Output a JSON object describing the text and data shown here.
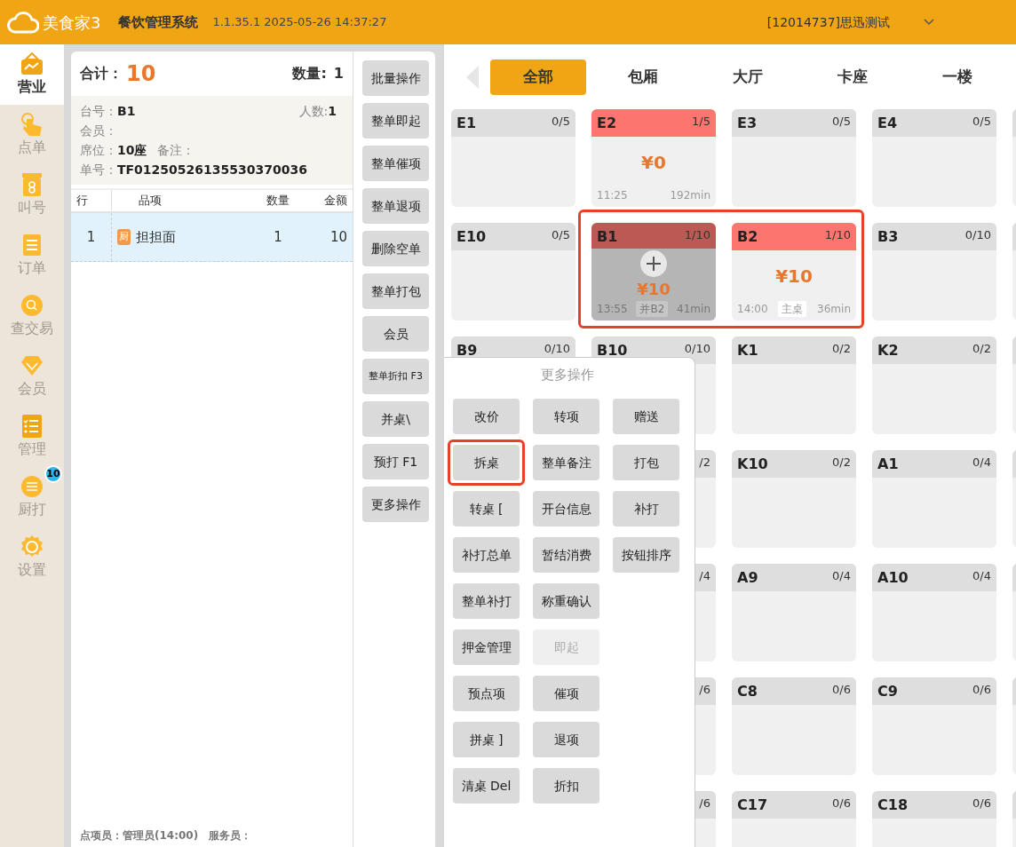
{
  "header": {
    "logo": "美食家3",
    "system": "餐饮管理系统",
    "version": "1.1.35.1 2025-05-26 14:37:27",
    "account": "[12014737]思迅测试"
  },
  "sidebar": {
    "items": [
      {
        "label": "营业",
        "selected": true
      },
      {
        "label": "点单",
        "selected": false
      },
      {
        "label": "叫号",
        "selected": false
      },
      {
        "label": "订单",
        "selected": false
      },
      {
        "label": "查交易",
        "selected": false
      },
      {
        "label": "会员",
        "selected": false
      },
      {
        "label": "管理",
        "selected": false
      },
      {
        "label": "厨打",
        "selected": false,
        "badge": "10"
      },
      {
        "label": "设置",
        "selected": false
      }
    ]
  },
  "order": {
    "total_label": "合计：",
    "total": "10",
    "qty_label": "数量:",
    "qty": "1",
    "info": [
      [
        {
          "label": "台号：",
          "value": "B1"
        },
        {
          "label": "人数:",
          "value": "1"
        }
      ],
      [
        {
          "label": "会员："
        }
      ],
      [
        {
          "label": "席位：",
          "value": "10座"
        },
        {
          "label": "备注："
        }
      ],
      [
        {
          "label": "单号：",
          "value": "TF01250526135530370036"
        }
      ]
    ],
    "columns": [
      "行",
      "品项",
      "数量",
      "金额"
    ],
    "rows": [
      {
        "line": "1",
        "tag": "厨",
        "item": "担担面",
        "qty": "1",
        "amount": "10",
        "selected": true
      }
    ],
    "footer": [
      {
        "label": "点项员：",
        "value": "管理员(14:00)"
      },
      {
        "label": "服务员："
      }
    ]
  },
  "actions": [
    {
      "label": "批量操作"
    },
    {
      "label": "整单即起"
    },
    {
      "label": "整单催项"
    },
    {
      "label": "整单退项"
    },
    {
      "label": "删除空单"
    },
    {
      "label": "整单打包"
    },
    {
      "label": "会员"
    },
    {
      "label": "整单折扣 F3",
      "small": true
    },
    {
      "label": "并桌\\"
    },
    {
      "label": "预打 F1"
    },
    {
      "label": "更多操作"
    }
  ],
  "areas": [
    {
      "label": "全部",
      "selected": true
    },
    {
      "label": "包厢",
      "selected": false
    },
    {
      "label": "大厅",
      "selected": false
    },
    {
      "label": "卡座",
      "selected": false
    },
    {
      "label": "一楼",
      "selected": false
    }
  ],
  "table_rows": [
    [
      {
        "name": "E1",
        "count": "0/5",
        "kind": "idle"
      },
      {
        "name": "E2",
        "count": "1/5",
        "kind": "occupied",
        "amount": "¥0",
        "time": "11:25",
        "duration": "192min"
      },
      {
        "name": "E3",
        "count": "0/5",
        "kind": "idle"
      },
      {
        "name": "E4",
        "count": "0/5",
        "kind": "idle"
      },
      {
        "kind": "idle"
      }
    ],
    [
      {
        "name": "E10",
        "count": "0/5",
        "kind": "idle"
      },
      {
        "name": "B1",
        "count": "1/10",
        "kind": "merged",
        "amount": "¥10",
        "time": "13:55",
        "tag": "并B2",
        "duration": "41min",
        "outlined": true
      },
      {
        "name": "B2",
        "count": "1/10",
        "kind": "occupied",
        "amount": "¥10",
        "time": "14:00",
        "tag": "主桌",
        "duration": "36min",
        "outlined": true
      },
      {
        "name": "B3",
        "count": "0/10",
        "kind": "idle"
      },
      {
        "kind": "idle"
      }
    ],
    [
      {
        "name": "B9",
        "count": "0/10",
        "kind": "idle"
      },
      {
        "name": "B10",
        "count": "0/10",
        "kind": "idle"
      },
      {
        "name": "K1",
        "count": "0/2",
        "kind": "idle"
      },
      {
        "name": "K2",
        "count": "0/2",
        "kind": "idle"
      },
      {
        "kind": "idle"
      }
    ],
    [
      null,
      {
        "count": "/2",
        "kind": "idle"
      },
      {
        "name": "K10",
        "count": "0/2",
        "kind": "idle"
      },
      {
        "name": "A1",
        "count": "0/4",
        "kind": "idle"
      },
      {
        "kind": "idle"
      }
    ],
    [
      null,
      {
        "count": "/4",
        "kind": "idle"
      },
      {
        "name": "A9",
        "count": "0/4",
        "kind": "idle"
      },
      {
        "name": "A10",
        "count": "0/4",
        "kind": "idle"
      },
      {
        "kind": "idle"
      }
    ],
    [
      null,
      {
        "count": "/6",
        "kind": "idle"
      },
      {
        "name": "C8",
        "count": "0/6",
        "kind": "idle"
      },
      {
        "name": "C9",
        "count": "0/6",
        "kind": "idle"
      },
      {
        "kind": "idle"
      }
    ],
    [
      null,
      {
        "count": "/6",
        "kind": "idle"
      },
      {
        "name": "C17",
        "count": "0/6",
        "kind": "idle"
      },
      {
        "name": "C18",
        "count": "0/6",
        "kind": "idle"
      },
      {
        "kind": "idle"
      }
    ]
  ],
  "more_menu": {
    "title": "更多操作",
    "rows": [
      [
        {
          "label": "改价",
          "disabled": false
        },
        {
          "label": "转项",
          "disabled": false
        },
        {
          "label": "赠送",
          "disabled": false
        }
      ],
      [
        {
          "label": "拆桌",
          "disabled": false,
          "outlined": true
        },
        {
          "label": "整单备注",
          "disabled": false
        },
        {
          "label": "打包",
          "disabled": false
        }
      ],
      [
        {
          "label": "转桌 [",
          "disabled": false
        },
        {
          "label": "开台信息",
          "disabled": false
        },
        {
          "label": "补打",
          "disabled": false
        }
      ],
      [
        {
          "label": "补打总单",
          "disabled": false
        },
        {
          "label": "暂结消费",
          "disabled": false
        },
        {
          "label": "按钮排序",
          "disabled": false
        }
      ],
      [
        {
          "label": "整单补打",
          "disabled": false
        },
        {
          "label": "称重确认",
          "disabled": false
        }
      ],
      [
        {
          "label": "押金管理",
          "disabled": false
        },
        {
          "label": "即起",
          "disabled": true
        }
      ],
      [
        {
          "label": "预点项",
          "disabled": false
        },
        {
          "label": "催项",
          "disabled": false
        }
      ],
      [
        {
          "label": "拼桌 ]",
          "disabled": false
        },
        {
          "label": "退项",
          "disabled": false
        }
      ],
      [
        {
          "label": "清桌 Del",
          "disabled": false
        },
        {
          "label": "折扣",
          "disabled": false
        }
      ]
    ]
  }
}
